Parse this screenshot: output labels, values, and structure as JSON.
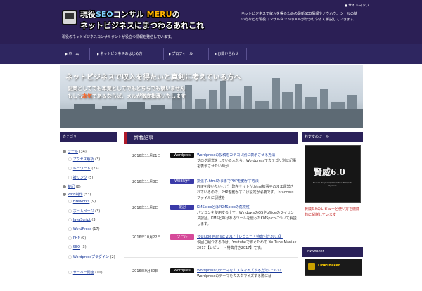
{
  "header": {
    "logo_line1_a": "現役",
    "logo_line1_seo": "SEO",
    "logo_line1_b": "コンサル",
    "logo_line1_meru": "MERU",
    "logo_line1_c": "の",
    "logo_line2": "ネットビジネスにまつわるあれこれ",
    "tagline": "現役のネットビジネスコンサルタントが役立つ情報を発信しています。",
    "description": "ネットビジネスで収入を得るための最新SEO情報やノウハウ、ツールの使い方などを現役コンサルタントのメルが分かりやすく解説していきます。",
    "sitemap": "サイトマップ"
  },
  "nav": {
    "items": [
      "ホーム",
      "ネットビジネスのはじめ方",
      "プロフィール",
      "お問い合わせ"
    ]
  },
  "banner": {
    "title": "ネットビジネスで収入を得たいと真剣に考えている方へ",
    "sub1": "副業としてでも本業としてでもどちらでも構いません",
    "sub2_a": "もしも",
    "sub2_hl": "本気",
    "sub2_b": "であるならば、メルが徹底指導いたします"
  },
  "sidebar_left": {
    "heading": "カテゴリー",
    "categories": [
      {
        "name": "ツール",
        "count": "(34)",
        "level": "parent"
      },
      {
        "name": "アクセス解析",
        "count": "(3)",
        "level": "child"
      },
      {
        "name": "キーワード",
        "count": "(25)",
        "level": "child"
      },
      {
        "name": "被リンク",
        "count": "(5)",
        "level": "child"
      },
      {
        "name": "雑記",
        "count": "(8)",
        "level": "parent"
      },
      {
        "name": "WEB制作",
        "count": "(53)",
        "level": "parent"
      },
      {
        "name": "Fireworks",
        "count": "(9)",
        "level": "child"
      },
      {
        "name": "ホームページ",
        "count": "(3)",
        "level": "child"
      },
      {
        "name": "JavaScript",
        "count": "(3)",
        "level": "child"
      },
      {
        "name": "WordPress",
        "count": "(17)",
        "level": "child"
      },
      {
        "name": "PHP",
        "count": "(9)",
        "level": "child"
      },
      {
        "name": "SEO",
        "count": "(3)",
        "level": "child"
      },
      {
        "name": "Wordpressプラグイン",
        "count": "(2)",
        "level": "child"
      },
      {
        "name": "サーバー関連",
        "count": "(10)",
        "level": "child"
      }
    ]
  },
  "main": {
    "heading": "新着記事",
    "posts": [
      {
        "date": "2016年11月21日",
        "badge": "Wordpres",
        "badge_color": "#111111",
        "title": "Wordpressの投稿をカテゴリ別に表示させる方法",
        "excerpt": "ブログ運営をしている人なら、Wordpressでカテゴリ別に記事を表示させたい時が"
      },
      {
        "date": "2016年11月8日",
        "badge": "WEB制作",
        "badge_color": "#3a3aa8",
        "title": "拡張子.htmlのままでPHPを動かす方法",
        "excerpt": "PHPを使いたいけど、既存サイトが.html拡張子のまま運営されているので、PHPを動かすには設定が必要です。.htaccessファイルに記述を"
      },
      {
        "date": "2016年11月2日",
        "badge": "雑記",
        "badge_color": "#3a3aa8",
        "title": "KMSpicoとは?KMSpicoの危険性",
        "excerpt": "パソコンを使用する上で、WindowsのOSやofficeのライセンス認証。KMSと呼ばれるツールを使ったKMSpicoについて解説します。"
      },
      {
        "date": "2016年10月22日",
        "badge": "ツール",
        "badge_color": "#d64a9a",
        "title": "YouTube Maniax 2017【レビュー・特典付き2017】",
        "excerpt": "今回ご紹介するのは、Youtubeで稼ぐための YouTube Maniax 2017【レビュー・特典付き2017】です。"
      },
      {
        "date": "2016年9月30日",
        "badge": "Wordpres",
        "badge_color": "#111111",
        "title": "Wordpressのテーマをカスタマイズする方法について",
        "excerpt": "Wordpressのテーマをカスタマイズする際には"
      }
    ]
  },
  "sidebar_right": {
    "book_heading": "おすすめツール",
    "book_title": "賢威6.0",
    "book_subtitle": "Search Engine Optimization Template System",
    "book_desc": "賢威6.0のレビューと使い方を徹底的に解説しています",
    "link_heading": "LinkShaker",
    "link_text": "LinkShaker"
  },
  "colors": {
    "header_bg": "#2b1f55",
    "accent_red": "#b01a2a",
    "link_blue": "#1a3a9a"
  }
}
